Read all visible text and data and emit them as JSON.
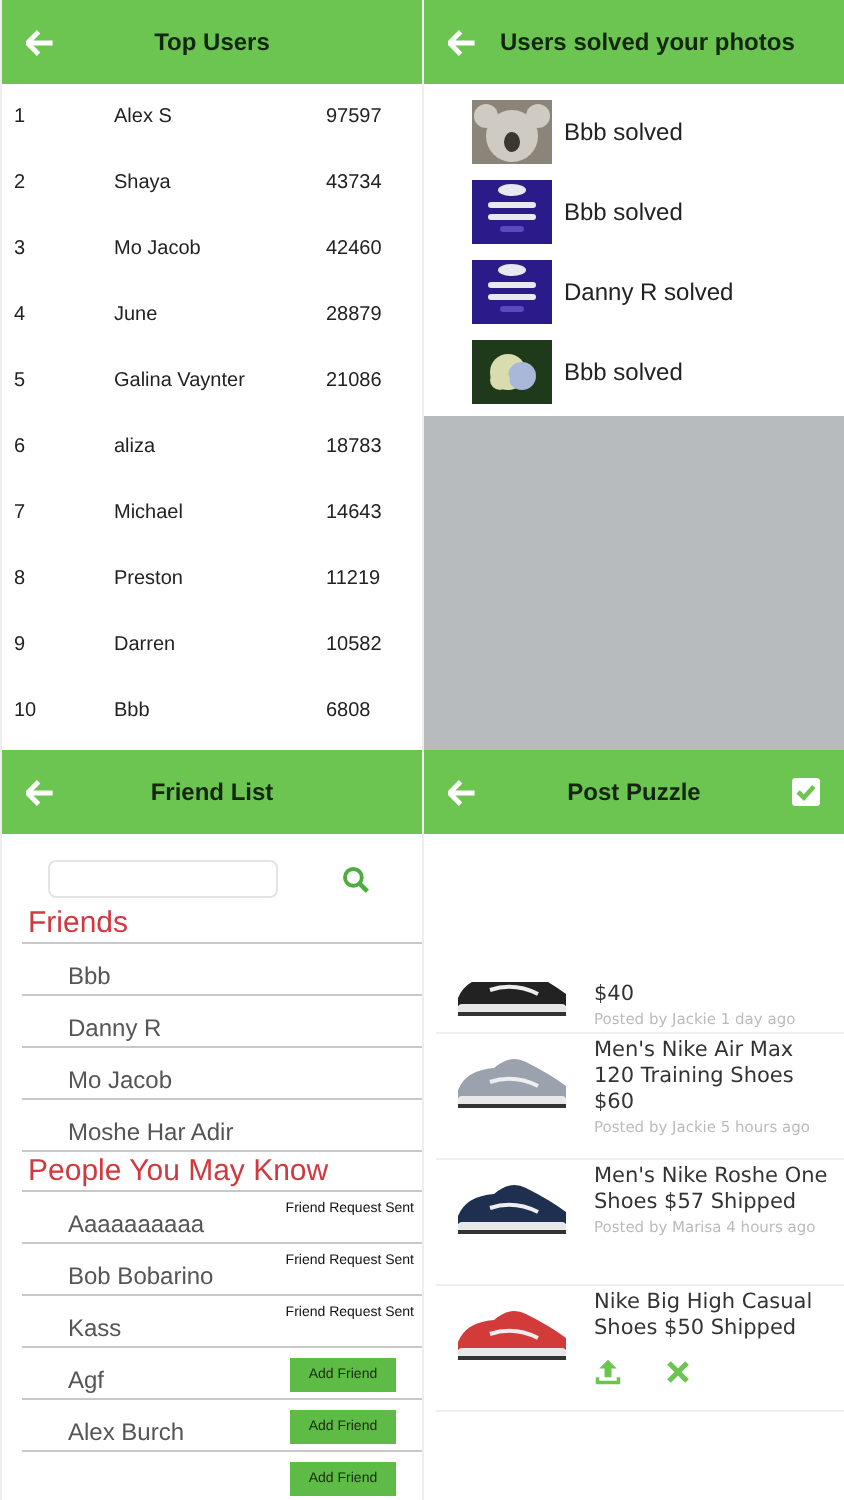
{
  "panels": [
    {
      "kind": "ranking",
      "title": "Top Users",
      "rows": [
        {
          "rank": "1",
          "name": "Alex S",
          "score": "97597"
        },
        {
          "rank": "2",
          "name": "Shaya",
          "score": "43734"
        },
        {
          "rank": "3",
          "name": "Mo Jacob",
          "score": "42460"
        },
        {
          "rank": "4",
          "name": "June",
          "score": "28879"
        },
        {
          "rank": "5",
          "name": "Galina Vaynter",
          "score": "21086"
        },
        {
          "rank": "6",
          "name": "aliza",
          "score": "18783"
        },
        {
          "rank": "7",
          "name": "Michael",
          "score": "14643"
        },
        {
          "rank": "8",
          "name": "Preston",
          "score": "11219"
        },
        {
          "rank": "9",
          "name": "Darren",
          "score": "10582"
        },
        {
          "rank": "10",
          "name": "Bbb",
          "score": "6808"
        }
      ]
    },
    {
      "kind": "solved",
      "title": "Users solved your photos",
      "items": [
        {
          "text": "Bbb solved"
        },
        {
          "text": "Bbb solved"
        },
        {
          "text": "Danny R solved"
        },
        {
          "text": "Bbb solved"
        }
      ]
    },
    {
      "kind": "friends",
      "title": "Friend List",
      "sections": [
        {
          "heading": "Friends",
          "people": [
            {
              "name": "Bbb"
            },
            {
              "name": "Danny R"
            },
            {
              "name": "Mo Jacob"
            },
            {
              "name": "Moshe Har Adir"
            }
          ]
        },
        {
          "heading": "People You May Know",
          "people": [
            {
              "name": "Aaaaaaaaaa",
              "kind": "sent",
              "status": "Friend Request Sent"
            },
            {
              "name": "Bob Bobarino",
              "kind": "sent",
              "status": "Friend Request Sent"
            },
            {
              "name": "Kass",
              "kind": "sent",
              "status": "Friend Request Sent"
            },
            {
              "name": "Agf",
              "kind": "add",
              "status": "Add Friend"
            },
            {
              "name": "Alex Burch",
              "kind": "add",
              "status": "Add Friend"
            },
            {
              "kind": "add",
              "status": "Add Friend"
            }
          ]
        }
      ]
    },
    {
      "kind": "post",
      "title": "Post Puzzle",
      "deals": [
        {
          "title": "$40",
          "meta": "Posted by Jackie 1 day ago"
        },
        {
          "title": "Men's Nike Air Max 120 Training Shoes $60",
          "meta": "Posted by Jackie 5 hours ago"
        },
        {
          "title": "Men's Nike Roshe One Shoes $57 Shipped",
          "meta": "Posted by Marisa 4 hours ago"
        },
        {
          "title": "Nike Big High Casual Shoes $50 Shipped"
        }
      ]
    }
  ]
}
